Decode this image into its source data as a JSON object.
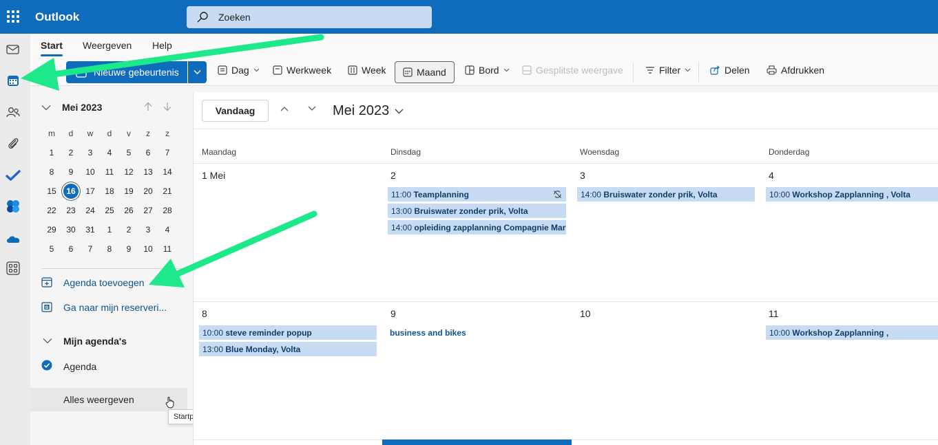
{
  "app": {
    "title": "Outlook"
  },
  "search": {
    "placeholder": "Zoeken"
  },
  "ribbon_tabs": [
    "Start",
    "Weergeven",
    "Help"
  ],
  "toolbar": {
    "new_event": "Nieuwe gebeurtenis",
    "day": "Dag",
    "work_week": "Werkweek",
    "week": "Week",
    "month": "Maand",
    "board": "Bord",
    "split_view": "Gesplitste weergave",
    "filter": "Filter",
    "share": "Delen",
    "print": "Afdrukken"
  },
  "minimonth": {
    "title": "Mei 2023",
    "dow": [
      "m",
      "d",
      "w",
      "d",
      "v",
      "z",
      "z"
    ],
    "weeks": [
      [
        "1",
        "2",
        "3",
        "4",
        "5",
        "6",
        "7"
      ],
      [
        "8",
        "9",
        "10",
        "11",
        "12",
        "13",
        "14"
      ],
      [
        "15",
        "16",
        "17",
        "18",
        "19",
        "20",
        "21"
      ],
      [
        "22",
        "23",
        "24",
        "25",
        "26",
        "27",
        "28"
      ],
      [
        "29",
        "30",
        "31",
        "1",
        "2",
        "3",
        "4"
      ],
      [
        "5",
        "6",
        "7",
        "8",
        "9",
        "10",
        "11"
      ]
    ],
    "today": "16"
  },
  "sidepane": {
    "add_calendar": "Agenda toevoegen",
    "bookings": "Ga naar mijn reserveri...",
    "my_calendars": "Mijn agenda's",
    "calendar": "Agenda",
    "show_all": "Alles weergeven"
  },
  "tooltip": "Startprogramma voor apps",
  "calendar": {
    "today_btn": "Vandaag",
    "title": "Mei 2023",
    "days": [
      "Maandag",
      "Dinsdag",
      "Woensdag",
      "Donderdag"
    ],
    "week1": {
      "nums": [
        "1 Mei",
        "2",
        "3",
        "4"
      ],
      "events": {
        "tue": [
          {
            "time": "11:00",
            "title": "Teamplanning"
          },
          {
            "time": "13:00",
            "title": "Bruiswater zonder prik, Volta"
          },
          {
            "time": "14:00",
            "title": "opleiding zapplanning Compagnie Mari"
          }
        ],
        "wed": [
          {
            "time": "14:00",
            "title": "Bruiswater zonder prik, Volta"
          }
        ],
        "thu": [
          {
            "time": "10:00",
            "title": "Workshop Zapplanning , Volta"
          }
        ]
      }
    },
    "week2": {
      "nums": [
        "8",
        "9",
        "10",
        "11"
      ],
      "events": {
        "mon": [
          {
            "time": "10:00",
            "title": "steve reminder popup"
          },
          {
            "time": "13:00",
            "title": "Blue Monday, Volta"
          }
        ],
        "tue": [
          {
            "title": "business and bikes"
          }
        ],
        "thu": [
          {
            "time": "10:00",
            "title": "Workshop Zapplanning ,"
          }
        ]
      }
    }
  },
  "colors": {
    "brand": "#0f6cbd",
    "event_bg": "#c7dcf2",
    "arrow": "#1de88a"
  }
}
